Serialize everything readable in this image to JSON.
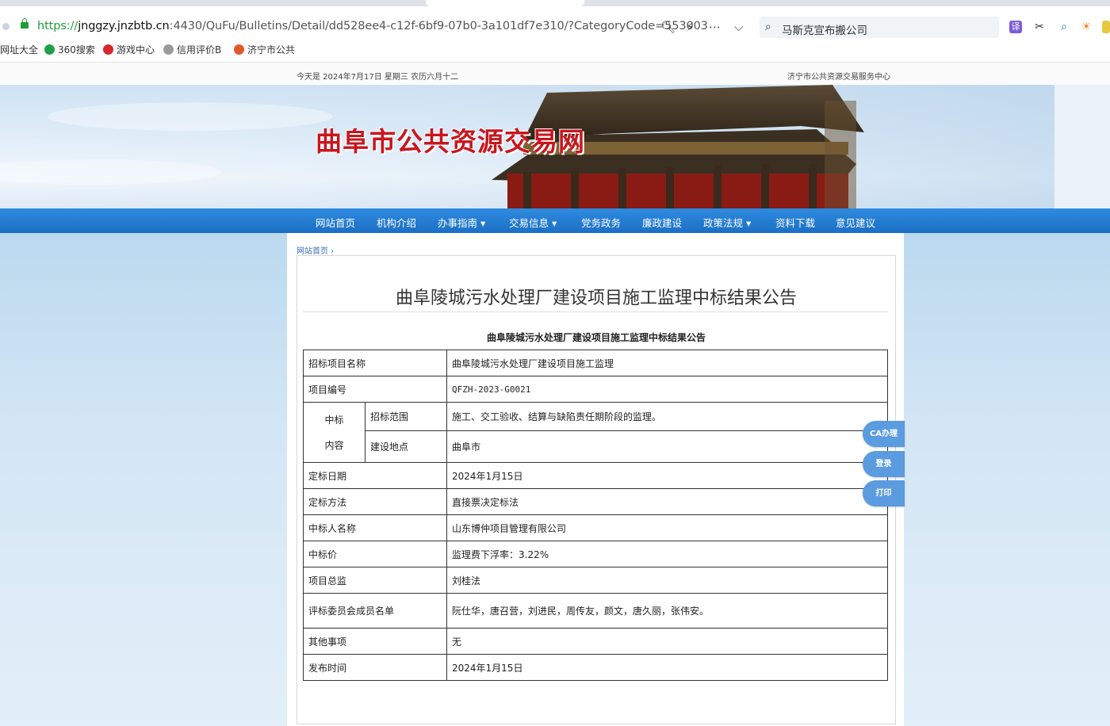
{
  "browser": {
    "url_scheme": "https://",
    "url_host": "jnggzy.jnzbtb.cn",
    "url_rest": ":4430/QuFu/Bulletins/Detail/dd528ee4-c12f-6bf9-07b0-3a101df7e310/?CategoryCode=553003",
    "search_text": "马斯克宣布搬公司",
    "bookmarks": [
      "网址大全",
      "360搜索",
      "游戏中心",
      "信用评价B",
      "济宁市公共"
    ]
  },
  "site": {
    "date_line": "今天是 2024年7月17日 星期三 农历六月十二",
    "org_line": "济宁市公共资源交易服务中心",
    "title": "曲阜市公共资源交易网",
    "nav": [
      "网站首页",
      "机构介绍",
      "办事指南 ▾",
      "交易信息 ▾",
      "党务政务",
      "廉政建设",
      "政策法规 ▾",
      "资料下载",
      "意见建议"
    ]
  },
  "breadcrumb": "网站首页 ›",
  "doc": {
    "title": "曲阜陵城污水处理厂建设项目施工监理中标结果公告",
    "subtitle": "曲阜陵城污水处理厂建设项目施工监理中标结果公告",
    "rows": {
      "project_name_label": "招标项目名称",
      "project_name": "曲阜陵城污水处理厂建设项目施工监理",
      "project_no_label": "项目编号",
      "project_no": "QFZH-2023-G0021",
      "content_label_1": "中标",
      "content_label_2": "内容",
      "scope_label": "招标范围",
      "scope": "施工、交工验收、结算与缺陷责任期阶段的监理。",
      "location_label": "建设地点",
      "location": "曲阜市",
      "date_label": "定标日期",
      "date": "2024年1月15日",
      "method_label": "定标方法",
      "method": "直接票决定标法",
      "winner_label": "中标人名称",
      "winner": "山东博仲项目管理有限公司",
      "price_label": "中标价",
      "price": "监理费下浮率：3.22%",
      "director_label": "项目总监",
      "director": "刘桂法",
      "committee_label": "评标委员会成员名单",
      "committee": "阮仕华，唐召营，刘进民，周传友，颜文，唐久丽，张伟安。",
      "other_label": "其他事项",
      "other": "无",
      "publish_label": "发布时间",
      "publish": "2024年1月15日"
    }
  },
  "side_buttons": [
    "CA办理",
    "登录",
    "打印"
  ]
}
